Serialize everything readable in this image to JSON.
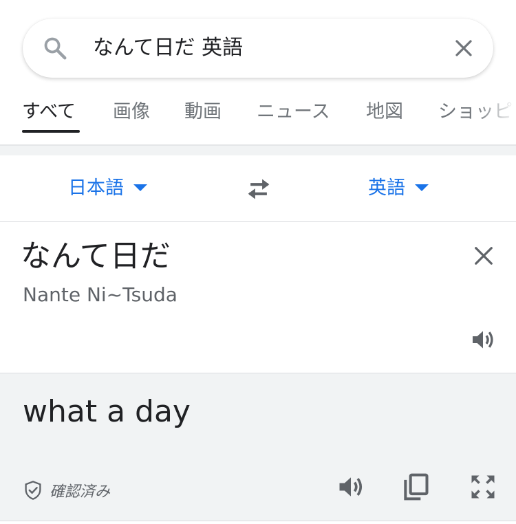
{
  "search": {
    "query": "なんて日だ 英語"
  },
  "tabs": [
    {
      "label": "すべて",
      "active": true
    },
    {
      "label": "画像"
    },
    {
      "label": "動画"
    },
    {
      "label": "ニュース"
    },
    {
      "label": "地図"
    },
    {
      "label": "ショッピ"
    }
  ],
  "translator": {
    "source_language": "日本語",
    "target_language": "英語",
    "source_text": "なんて日だ",
    "source_transliteration": "Nante Ni~Tsuda",
    "translated_text": "what a day",
    "verified_label": "確認済み"
  },
  "colors": {
    "accent": "#1a73e8",
    "text": "#202124",
    "secondary_text": "#5f6368",
    "result_background": "#f1f3f4"
  },
  "icons": {
    "search": "search-icon",
    "clear": "close-icon",
    "swap": "swap-arrows-icon",
    "speaker": "speaker-icon",
    "copy": "copy-icon",
    "fullscreen": "fullscreen-icon",
    "verified": "shield-check-icon"
  }
}
